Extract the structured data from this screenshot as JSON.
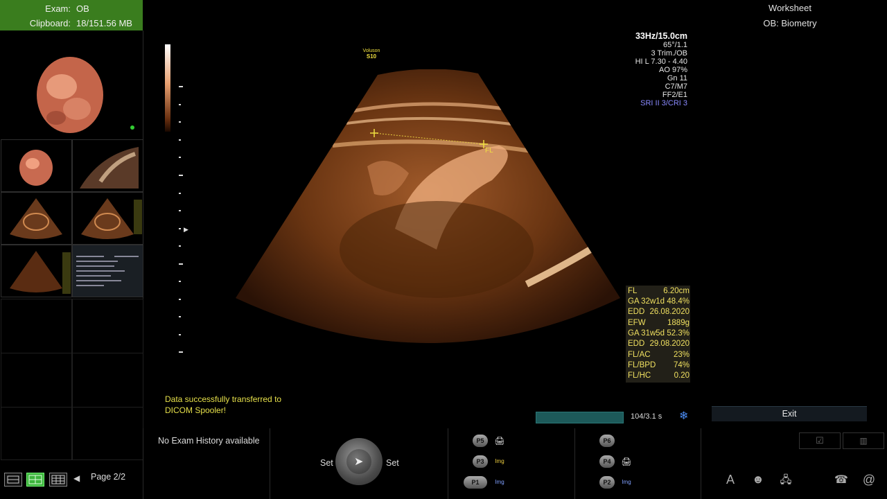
{
  "exam": {
    "exam_label": "Exam:",
    "exam_value": "OB",
    "clipboard_label": "Clipboard:",
    "clipboard_value": "18/151.56 MB"
  },
  "probe": {
    "line1": "Voluson",
    "line2": "S10"
  },
  "params": [
    "33Hz/15.0cm",
    "65°/1.1",
    "3 Trim./OB",
    "HI L  7.30 - 4.40",
    "AO 97%",
    "Gn  11",
    "C7/M7",
    "FF2/E1",
    "SRI II 3/CRI 3"
  ],
  "caliper_label": "FL",
  "measurements": [
    {
      "k": "FL",
      "v": "6.20cm"
    },
    {
      "k": "GA 32w1d",
      "v": "48.4%"
    },
    {
      "k": "EDD",
      "v": "26.08.2020"
    },
    {
      "k": "EFW",
      "v": "1889g"
    },
    {
      "k": "GA 31w5d",
      "v": "52.3%"
    },
    {
      "k": "EDD",
      "v": "29.08.2020"
    },
    {
      "k": "FL/AC",
      "v": "23%"
    },
    {
      "k": "FL/BPD",
      "v": "74%"
    },
    {
      "k": "FL/HC",
      "v": "0.20"
    }
  ],
  "worksheet": {
    "title": "Worksheet",
    "subtitle": "OB: Biometry",
    "exit": "Exit"
  },
  "status": {
    "line1": "Data successfully transferred to",
    "line2": "DICOM Spooler!"
  },
  "cine": {
    "text": "104/3.1 s",
    "progress": 1.0
  },
  "history": "No Exam History available",
  "trackball": {
    "left": "Set",
    "right": "Set"
  },
  "pagination": "Page 2/2",
  "pbuttons": {
    "p5": "P5",
    "p3": "P3",
    "p1": "P1",
    "p6": "P6",
    "p4": "P4",
    "p2": "P2"
  },
  "icons": {
    "img": "Img",
    "font": "A",
    "at": "@"
  },
  "colors": {
    "exam_header": "#3a7d1e",
    "measure_text": "#f0e060",
    "status_text": "#e6e04a",
    "progress": "#1d5a5a"
  }
}
